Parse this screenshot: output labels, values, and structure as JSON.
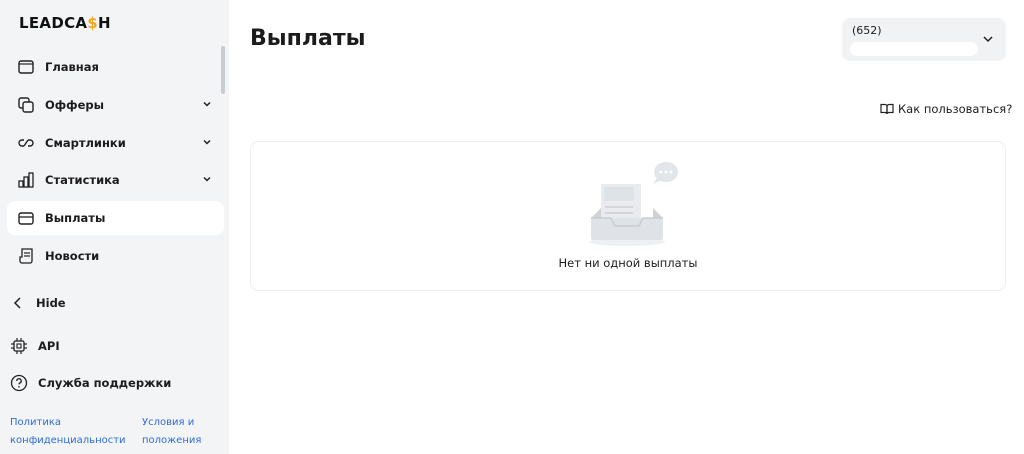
{
  "brand": {
    "logo_prefix": "LEADCA",
    "logo_dollar": "$",
    "logo_suffix": "H"
  },
  "sidebar": {
    "items": [
      {
        "label": "Главная",
        "icon": "home-window-icon",
        "expandable": false,
        "active": false
      },
      {
        "label": "Офферы",
        "icon": "offers-icon",
        "expandable": true,
        "active": false
      },
      {
        "label": "Смартлинки",
        "icon": "link-icon",
        "expandable": true,
        "active": false
      },
      {
        "label": "Статистика",
        "icon": "bar-chart-icon",
        "expandable": true,
        "active": false
      },
      {
        "label": "Выплаты",
        "icon": "card-icon",
        "expandable": false,
        "active": true
      },
      {
        "label": "Новости",
        "icon": "news-icon",
        "expandable": false,
        "active": false
      }
    ],
    "hide_label": "Hide",
    "api_label": "API",
    "support_label": "Служба поддержки",
    "footer": {
      "privacy_line1": "Политика",
      "privacy_line2": "конфиденциальности",
      "terms_line1": "Условия и",
      "terms_line2": "положения"
    }
  },
  "main": {
    "title": "Выплаты",
    "account": {
      "id": "(652)"
    },
    "help_label": "Как пользоваться?",
    "empty_message": "Нет ни одной выплаты"
  },
  "colors": {
    "accent": "#f5a623",
    "link": "#2f6bd8",
    "sidebar_bg": "#f3f4f6"
  }
}
